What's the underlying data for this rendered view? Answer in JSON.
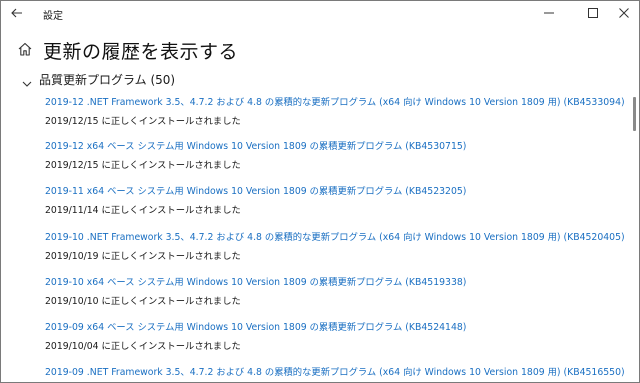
{
  "window": {
    "title": "設定"
  },
  "icons": {
    "back": "back-arrow-icon",
    "minimize": "minimize-icon",
    "maximize": "maximize-icon",
    "close": "close-icon",
    "home": "home-icon",
    "chevron": "chevron-down-icon"
  },
  "page": {
    "title": "更新の履歴を表示する"
  },
  "section": {
    "title": "品質更新プログラム (50)"
  },
  "updates": [
    {
      "name": "2019-12 .NET Framework 3.5、4.7.2 および 4.8 の累積的な更新プログラム (x64 向け Windows 10 Version 1809 用) (KB4533094)",
      "status": "2019/12/15 に正しくインストールされました"
    },
    {
      "name": "2019-12 x64 ベース システム用 Windows 10 Version 1809 の累積更新プログラム (KB4530715)",
      "status": "2019/12/15 に正しくインストールされました"
    },
    {
      "name": "2019-11 x64 ベース システム用 Windows 10 Version 1809 の累積更新プログラム (KB4523205)",
      "status": "2019/11/14 に正しくインストールされました"
    },
    {
      "name": "2019-10 .NET Framework 3.5、4.7.2 および 4.8 の累積的な更新プログラム (x64 向け Windows 10 Version 1809 用) (KB4520405)",
      "status": "2019/10/19 に正しくインストールされました"
    },
    {
      "name": "2019-10 x64 ベース システム用 Windows 10 Version 1809 の累積更新プログラム (KB4519338)",
      "status": "2019/10/10 に正しくインストールされました"
    },
    {
      "name": "2019-09 x64 ベース システム用 Windows 10 Version 1809 の累積更新プログラム (KB4524148)",
      "status": "2019/10/04 に正しくインストールされました"
    },
    {
      "name": "2019-09 .NET Framework 3.5、4.7.2 および 4.8 の累積的な更新プログラム (x64 向け Windows 10 Version 1809 用) (KB4516550)",
      "status": ""
    }
  ],
  "colors": {
    "link": "#1a6fc2",
    "text": "#1a1a1a",
    "scrollbar": "#8a8a8a"
  }
}
